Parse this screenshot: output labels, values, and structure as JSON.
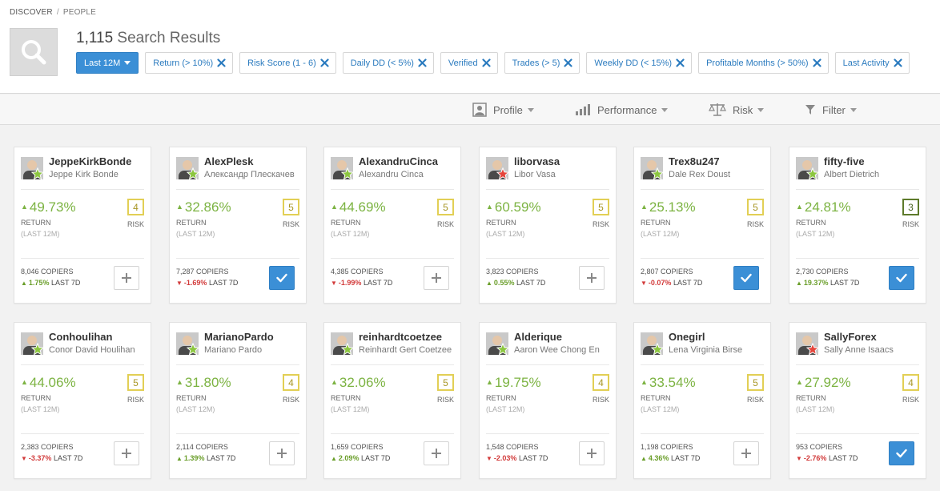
{
  "breadcrumb": {
    "root": "DISCOVER",
    "separator": "/",
    "current": "PEOPLE"
  },
  "results": {
    "count": "1,115",
    "label": "Search Results"
  },
  "period_button": {
    "label": "Last 12M"
  },
  "filters": [
    {
      "label": "Return (> 10%)"
    },
    {
      "label": "Risk Score (1 - 6)"
    },
    {
      "label": "Daily DD (< 5%)"
    },
    {
      "label": "Verified"
    },
    {
      "label": "Trades (> 5)"
    },
    {
      "label": "Weekly DD (< 15%)"
    },
    {
      "label": "Profitable Months (> 50%)"
    },
    {
      "label": "Last Activity"
    }
  ],
  "toolbar": {
    "profile": "Profile",
    "performance": "Performance",
    "risk": "Risk",
    "filter": "Filter"
  },
  "card_labels": {
    "return": "RETURN",
    "period": "(LAST 12M)",
    "risk": "RISK",
    "copiers_suffix": "COPIERS",
    "last7_suffix": "LAST 7D"
  },
  "colors": {
    "accent_blue": "#3b8fd6",
    "positive_green": "#7cb342",
    "negative_red": "#d23b3b",
    "star_green": "#8cc63f",
    "star_red": "#e5453b"
  },
  "traders": [
    {
      "username": "JeppeKirkBonde",
      "fullname": "Jeppe Kirk Bonde",
      "star": "green",
      "return": "49.73%",
      "risk": "4",
      "copiers": "8,046",
      "last7": "1.75%",
      "last7_dir": "pos",
      "copied": false
    },
    {
      "username": "AlexPlesk",
      "fullname": "Александр Плескачев",
      "star": "green",
      "return": "32.86%",
      "risk": "5",
      "copiers": "7,287",
      "last7": "-1.69%",
      "last7_dir": "neg",
      "copied": true
    },
    {
      "username": "AlexandruCinca",
      "fullname": "Alexandru Cinca",
      "star": "green",
      "return": "44.69%",
      "risk": "5",
      "copiers": "4,385",
      "last7": "-1.99%",
      "last7_dir": "neg",
      "copied": false
    },
    {
      "username": "liborvasa",
      "fullname": "Libor Vasa",
      "star": "red",
      "return": "60.59%",
      "risk": "5",
      "copiers": "3,823",
      "last7": "0.55%",
      "last7_dir": "pos",
      "copied": false
    },
    {
      "username": "Trex8u247",
      "fullname": "Dale Rex Doust",
      "star": "green",
      "return": "25.13%",
      "risk": "5",
      "copiers": "2,807",
      "last7": "-0.07%",
      "last7_dir": "neg",
      "copied": true
    },
    {
      "username": "fifty-five",
      "fullname": "Albert Dietrich",
      "star": "green",
      "return": "24.81%",
      "risk": "3",
      "copiers": "2,730",
      "last7": "19.37%",
      "last7_dir": "pos",
      "copied": true
    },
    {
      "username": "Conhoulihan",
      "fullname": "Conor David Houlihan",
      "star": "green",
      "return": "44.06%",
      "risk": "5",
      "copiers": "2,383",
      "last7": "-3.37%",
      "last7_dir": "neg",
      "copied": false
    },
    {
      "username": "MarianoPardo",
      "fullname": "Mariano Pardo",
      "star": "green",
      "return": "31.80%",
      "risk": "4",
      "copiers": "2,114",
      "last7": "1.39%",
      "last7_dir": "pos",
      "copied": false
    },
    {
      "username": "reinhardtcoetzee",
      "fullname": "Reinhardt Gert Coetzee",
      "star": "green",
      "return": "32.06%",
      "risk": "5",
      "copiers": "1,659",
      "last7": "2.09%",
      "last7_dir": "pos",
      "copied": false
    },
    {
      "username": "Alderique",
      "fullname": "Aaron Wee Chong En",
      "star": "green",
      "return": "19.75%",
      "risk": "4",
      "copiers": "1,548",
      "last7": "-2.03%",
      "last7_dir": "neg",
      "copied": false
    },
    {
      "username": "Onegirl",
      "fullname": "Lena Virginia Birse",
      "star": "green",
      "return": "33.54%",
      "risk": "5",
      "copiers": "1,198",
      "last7": "4.36%",
      "last7_dir": "pos",
      "copied": false
    },
    {
      "username": "SallyForex",
      "fullname": "Sally Anne Isaacs",
      "star": "red",
      "return": "27.92%",
      "risk": "4",
      "copiers": "953",
      "last7": "-2.76%",
      "last7_dir": "neg",
      "copied": true
    }
  ]
}
